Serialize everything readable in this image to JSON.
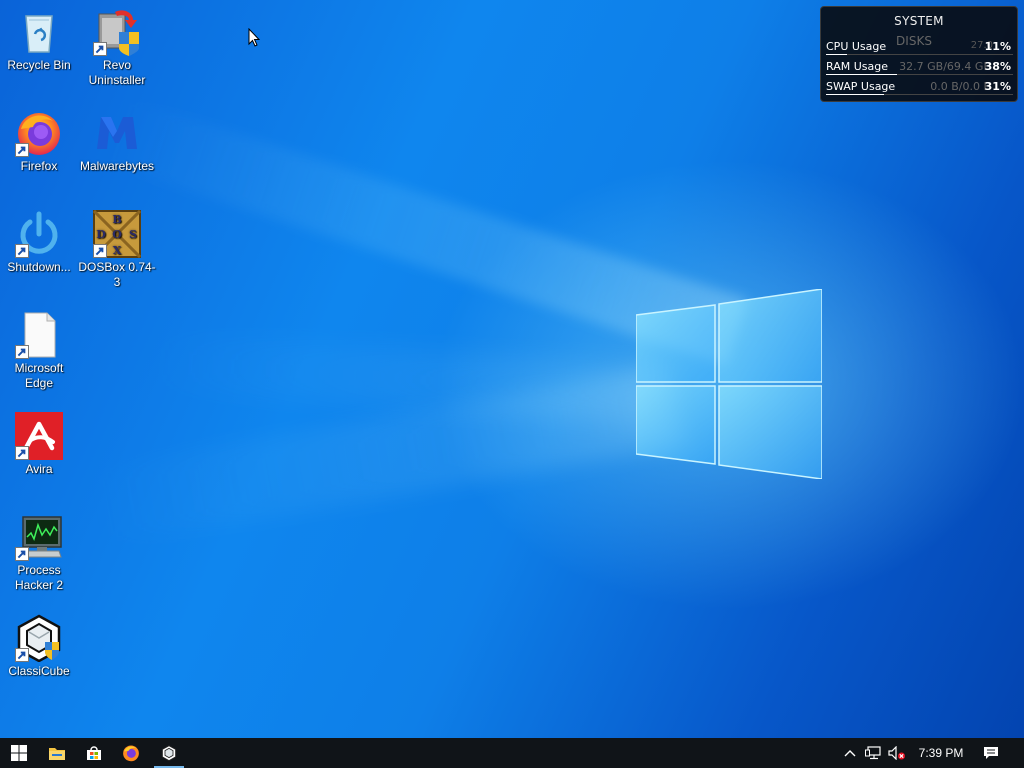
{
  "desktop": {
    "icons": [
      {
        "label": "Recycle Bin",
        "icon": "recycle-bin-icon",
        "shortcut": false
      },
      {
        "label": "Revo Uninstaller",
        "icon": "revo-uninstaller-icon",
        "shortcut": true
      },
      {
        "label": "Firefox",
        "icon": "firefox-icon",
        "shortcut": true
      },
      {
        "label": "Malwarebytes",
        "icon": "malwarebytes-icon",
        "shortcut": false
      },
      {
        "label": "Shutdown...",
        "icon": "power-icon",
        "shortcut": true
      },
      {
        "label": "DOSBox 0.74-3",
        "icon": "dosbox-icon",
        "shortcut": true
      },
      {
        "label": "Microsoft Edge",
        "icon": "blank-document-icon",
        "shortcut": true
      },
      {
        "label": "Avira",
        "icon": "avira-icon",
        "shortcut": true
      },
      {
        "label": "Process Hacker 2",
        "icon": "process-hacker-icon",
        "shortcut": true
      },
      {
        "label": "ClassiCube",
        "icon": "classicube-icon",
        "shortcut": true
      }
    ],
    "dosbox_letters": [
      "B",
      "O",
      "D",
      "O",
      "S",
      "X"
    ]
  },
  "sysmon": {
    "title": "SYSTEM",
    "overlay_title": "DISKS",
    "overlay_detail": "27.0",
    "rows": [
      {
        "label": "CPU Usage",
        "detail": "",
        "value": "11%",
        "fraction": 0.11
      },
      {
        "label": "RAM Usage",
        "detail": "32.7 GB/69.4 GB",
        "value": "38%",
        "fraction": 0.38
      },
      {
        "label": "SWAP Usage",
        "detail": "0.0 B/0.0 B",
        "value": "31%",
        "fraction": 0.31
      }
    ]
  },
  "taskbar": {
    "buttons": [
      {
        "name": "start-button",
        "icon": "windows-logo-icon"
      },
      {
        "name": "file-explorer-button",
        "icon": "folder-icon"
      },
      {
        "name": "microsoft-store-button",
        "icon": "store-bag-icon"
      },
      {
        "name": "firefox-taskbar-button",
        "icon": "firefox-icon"
      },
      {
        "name": "classicube-taskbar-button",
        "icon": "classicube-icon",
        "active": true
      }
    ],
    "tray": {
      "icons": [
        "chevron-up-icon",
        "network-icon",
        "volume-muted-icon"
      ],
      "clock": "7:39 PM",
      "notification_icon": "action-center-icon"
    }
  },
  "colors": {
    "wallpaper": "#0e7fe8",
    "taskbar": "#101418",
    "active_indicator": "#76b9ed",
    "avira_red": "#e02027"
  }
}
